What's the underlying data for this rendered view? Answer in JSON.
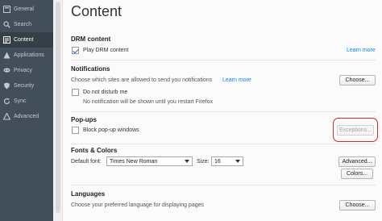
{
  "sidebar": {
    "items": [
      {
        "label": "General",
        "icon": "general-icon",
        "active": false
      },
      {
        "label": "Search",
        "icon": "search-icon",
        "active": false
      },
      {
        "label": "Content",
        "icon": "content-icon",
        "active": true
      },
      {
        "label": "Applications",
        "icon": "applications-icon",
        "active": false
      },
      {
        "label": "Privacy",
        "icon": "privacy-icon",
        "active": false
      },
      {
        "label": "Security",
        "icon": "security-icon",
        "active": false
      },
      {
        "label": "Sync",
        "icon": "sync-icon",
        "active": false
      },
      {
        "label": "Advanced",
        "icon": "advanced-icon",
        "active": false
      }
    ]
  },
  "page": {
    "title": "Content"
  },
  "drm": {
    "heading": "DRM content",
    "checkbox_label": "Play DRM content",
    "checked": true,
    "learn_more": "Learn more"
  },
  "notifications": {
    "heading": "Notifications",
    "description": "Choose which sites are allowed to send you notifications",
    "learn_more": "Learn more",
    "choose_button": "Choose...",
    "dnd_label": "Do not disturb me",
    "dnd_checked": false,
    "dnd_note": "No notification will be shown until you restart Firefox"
  },
  "popups": {
    "heading": "Pop-ups",
    "checkbox_label": "Block pop-up windows",
    "checked": false,
    "exceptions_button": "Exceptions..."
  },
  "fonts": {
    "heading": "Fonts & Colors",
    "default_font_label": "Default font:",
    "default_font_value": "Times New Roman",
    "size_label": "Size:",
    "size_value": "16",
    "advanced_button": "Advanced...",
    "colors_button": "Colors..."
  },
  "languages": {
    "heading": "Languages",
    "description": "Choose your preferred language for displaying pages",
    "choose_button": "Choose..."
  },
  "colors": {
    "sidebar_bg": "#424f5a",
    "sidebar_active": "#343f48",
    "link": "#0a84ff",
    "highlight": "#d42a2a"
  }
}
